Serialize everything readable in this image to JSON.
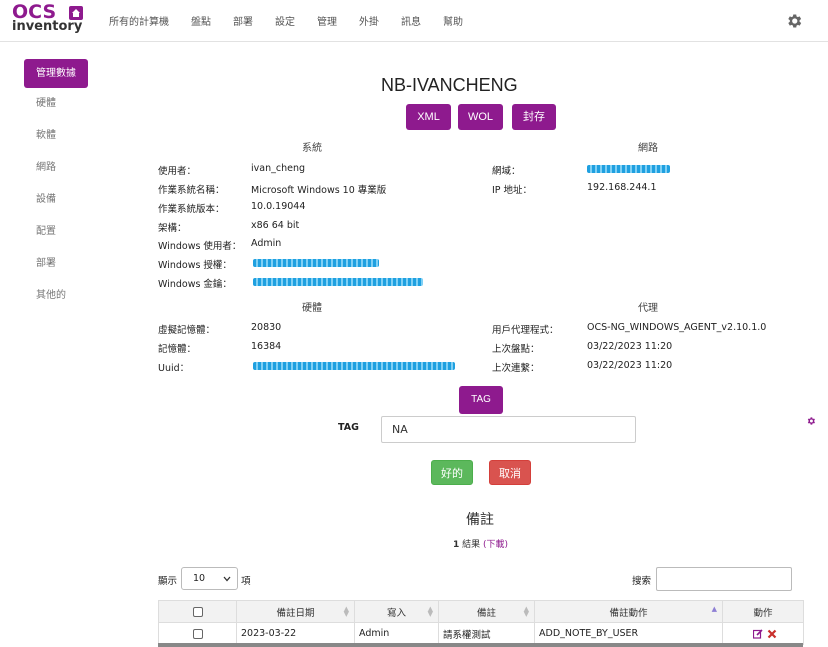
{
  "brand": {
    "logo_top": "OCS",
    "logo_bottom": "inventory"
  },
  "nav": [
    "所有的計算機",
    "盤點",
    "部署",
    "設定",
    "管理",
    "外掛",
    "訊息",
    "幫助"
  ],
  "sidebar": {
    "active": "管理數據",
    "items": [
      "硬體",
      "軟體",
      "網路",
      "設備",
      "配置",
      "部署",
      "其他的"
    ]
  },
  "machine": {
    "name": "NB-IVANCHENG"
  },
  "buttons": {
    "xml": "XML",
    "wol": "WOL",
    "archive": "封存",
    "tag": "TAG",
    "ok": "好的",
    "cancel": "取消"
  },
  "system": {
    "title": "系統",
    "rows": [
      {
        "label": "使用者：",
        "value": "ivan_cheng"
      },
      {
        "label": "作業系統名稱：",
        "value": "Microsoft Windows 10 專業版"
      },
      {
        "label": "作業系統版本：",
        "value": "10.0.19044"
      },
      {
        "label": "架構：",
        "value": "x86 64 bit"
      },
      {
        "label": "Windows 使用者：",
        "value": "Admin"
      },
      {
        "label": "Windows 授權：",
        "value": ""
      },
      {
        "label": "Windows 金鑰：",
        "value": ""
      }
    ]
  },
  "network": {
    "title": "網路",
    "rows": [
      {
        "label": "網域：",
        "value": ""
      },
      {
        "label": "IP 地址：",
        "value": "192.168.244.1"
      }
    ]
  },
  "hardware": {
    "title": "硬體",
    "rows": [
      {
        "label": "虛擬記憶體：",
        "value": "20830"
      },
      {
        "label": "記憶體：",
        "value": "16384"
      },
      {
        "label": "Uuid：",
        "value": ""
      }
    ]
  },
  "agent": {
    "title": "代理",
    "rows": [
      {
        "label": "用戶代理程式：",
        "value": "OCS-NG_WINDOWS_AGENT_v2.10.1.0"
      },
      {
        "label": "上次盤點：",
        "value": "03/22/2023 11:20"
      },
      {
        "label": "上次連繫：",
        "value": "03/22/2023 11:20"
      }
    ]
  },
  "tag": {
    "label": "TAG",
    "value": "NA"
  },
  "notes": {
    "title": "備註",
    "result_count": "1",
    "result_text": " 結果 ",
    "download": "(下載)",
    "show_label": "顯示",
    "page_size": "10",
    "items_label": "項",
    "search_label": "搜索",
    "columns": [
      "備註日期",
      "寫入",
      "備註",
      "備註動作",
      "動作"
    ],
    "rows": [
      {
        "date": "2023-03-22",
        "author": "Admin",
        "note": "請系權測試",
        "action": "ADD_NOTE_BY_USER"
      }
    ]
  },
  "colors": {
    "accent": "#8e1a8e",
    "ok": "#5cb85c",
    "cancel": "#d9534f"
  }
}
